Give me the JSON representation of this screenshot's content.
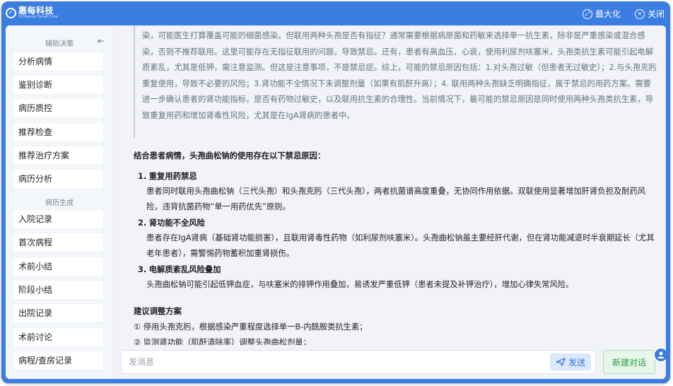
{
  "app": {
    "logo_name": "惠每科技",
    "logo_sub": "Dr.Mayson Smart Care",
    "maximize": "最大化",
    "close": "关闭"
  },
  "sidebar": {
    "section1": "辅助决策",
    "items1": [
      "分析病情",
      "鉴别诊断",
      "病历质控",
      "推荐检查",
      "推荐治疗方案",
      "病历分析"
    ],
    "section2": "病历生成",
    "items2": [
      "入院记录",
      "首次病程",
      "术前小结",
      "阶段小结",
      "出院记录",
      "术前讨论",
      "病程/查房记录"
    ]
  },
  "quote": "染，可能医生打算覆盖可能的细菌感染。但联用两种头孢是否有指征？通常需要根据病原菌和药敏来选择单一抗生素，除非是严重感染或混合感染，否则不推荐联用。这里可能存在无指征联用的问题，导致禁忌。还有，患者有高血压、心衰，使用利尿剂呋塞米，头孢类抗生素可能引起电解质紊乱，尤其是低钾，需注意监测。但这是注意事项，不是禁忌症。综上，可能的禁忌原因包括：1.对头孢过敏（但患者无过敏史）；2.与头孢克肟重复使用，导致不必要的风险；3.肾功能不全情况下未调整剂量（如果有肌酐升高）；4. 联用两种头孢缺乏明确指征，属于禁忌的用药方案。需要进一步确认患者的肾功能指标，是否有药物过敏史，以及联用抗生素的合理性。当前情况下，最可能的禁忌原因是同时使用两种头孢类抗生素，导致重复用药和增加肾毒性风险，尤其是在IgA肾病的患者中。",
  "answer": {
    "heading": "结合患者病情，头孢曲松钠的使用存在以下禁忌原因：",
    "items": [
      {
        "num": "1.",
        "title": "重复用药禁忌",
        "body": "患者同时联用头孢曲松钠（三代头孢）和头孢克肟（三代头孢），两者抗菌谱高度重叠，无协同作用依据。双联使用显著增加肝肾负担及耐药风险，违背抗菌药物“单一用药优先”原则。"
      },
      {
        "num": "2.",
        "title": "肾功能不全风险",
        "body": "患者存在IgA肾病（基础肾功能损害），且联用肾毒性药物（如利尿剂呋塞米）。头孢曲松钠虽主要经肝代谢，但在肾功能减退时半衰期延长（尤其老年患者），需警惕药物蓄积加重肾损伤。"
      },
      {
        "num": "3.",
        "title": "电解质紊乱风险叠加",
        "body": "头孢曲松钠可能引起低钾血症，与呋塞米的排钾作用叠加，易诱发严重低钾（患者未提及补钾治疗），增加心律失常风险。"
      }
    ],
    "advice_title": "建议调整方案",
    "advice": [
      "① 停用头孢克肟，根据感染严重程度选择单一B-内酰胺类抗生素；",
      "② 监测肾功能（肌酐清除率）调整头孢曲松剂量；"
    ]
  },
  "input": {
    "placeholder": "发消息",
    "send": "发送",
    "new_chat": "新建对话"
  }
}
